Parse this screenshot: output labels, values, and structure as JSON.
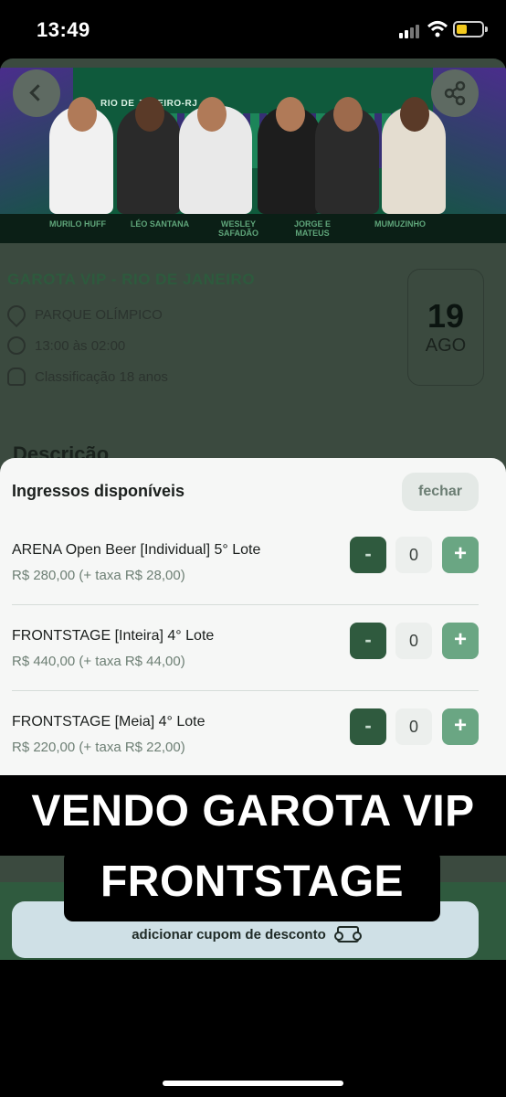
{
  "status_bar": {
    "time": "13:49",
    "battery_level": 0.3
  },
  "event": {
    "banner_city": "RIO DE JANEIRO-RJ",
    "artists": [
      "MURILO HUFF",
      "LÉO SANTANA",
      "WESLEY SAFADÃO",
      "JORGE E MATEUS",
      "MUMUZINHO"
    ],
    "title": "GAROTA VIP - RIO DE JANEIRO",
    "venue": "PARQUE OLÍMPICO",
    "time": "13:00 às 02:00",
    "rating": "Classificação 18 anos",
    "date_day": "19",
    "date_month": "AGO",
    "description_heading": "Descrição"
  },
  "sheet": {
    "title": "Ingressos disponíveis",
    "close_label": "fechar",
    "tickets": [
      {
        "name": "ARENA Open Beer [Individual] 5° Lote",
        "price": "R$ 280,00 (+ taxa R$ 28,00)",
        "minus": "-",
        "qty": "0",
        "plus": "+"
      },
      {
        "name": "FRONTSTAGE [Inteira] 4° Lote",
        "price": "R$ 440,00 (+ taxa R$ 44,00)",
        "minus": "-",
        "qty": "0",
        "plus": "+"
      },
      {
        "name": "FRONTSTAGE [Meia] 4° Lote",
        "price": "R$ 220,00 (+ taxa R$ 22,00)",
        "minus": "-",
        "qty": "0",
        "plus": "+"
      }
    ]
  },
  "overlay": {
    "line1": "VENDO GAROTA VIP",
    "line2": "FRONTSTAGE"
  },
  "footer": {
    "coupon_label": "adicionar cupom de desconto"
  },
  "colors": {
    "accent_dark": "#2f5a3e",
    "accent_light": "#6aa683",
    "sheet_bg": "#f6f7f6"
  },
  "icons": [
    "back-icon",
    "share-icon",
    "location-icon",
    "clock-icon",
    "people-icon",
    "ticket-icon"
  ]
}
